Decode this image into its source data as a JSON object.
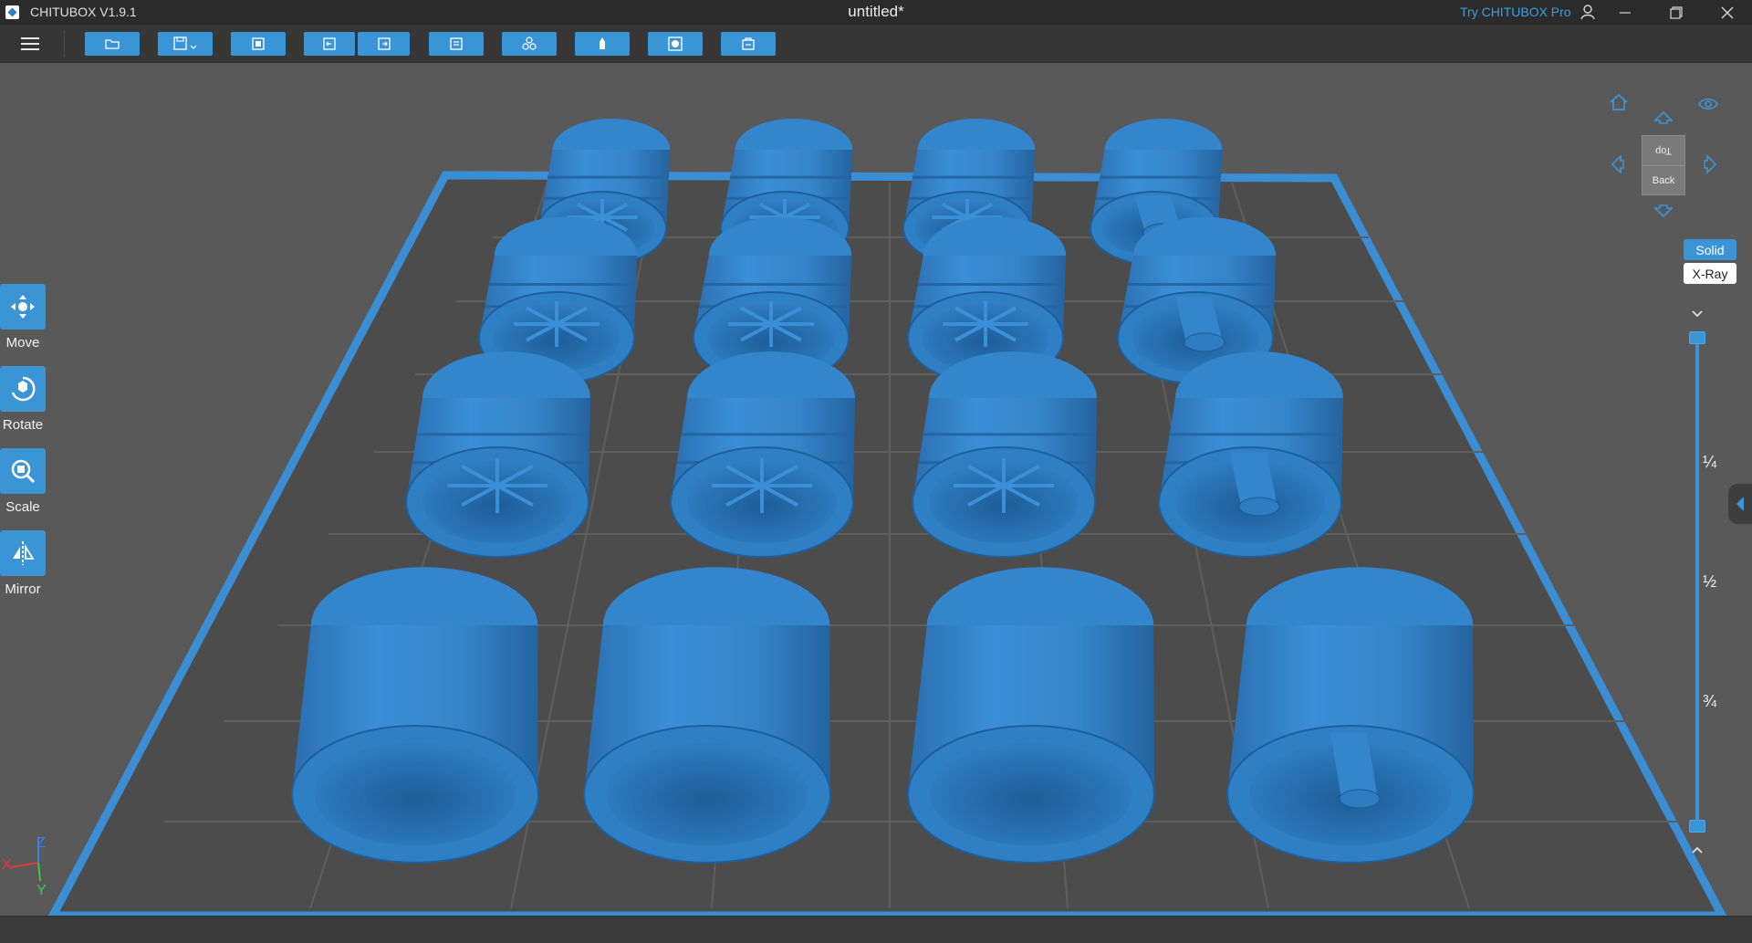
{
  "app": {
    "name": "CHITUBOX V1.9.1",
    "document_title": "untitled*",
    "try_pro": "Try CHITUBOX Pro"
  },
  "toolbar": {
    "buttons": [
      {
        "name": "open-file",
        "icon": "folder-icon"
      },
      {
        "name": "save",
        "icon": "save-icon"
      },
      {
        "name": "screenshot",
        "icon": "capture-icon"
      },
      {
        "name": "undo",
        "icon": "undo-icon"
      },
      {
        "name": "redo",
        "icon": "redo-icon"
      },
      {
        "name": "layout",
        "icon": "layout-icon"
      },
      {
        "name": "multiply",
        "icon": "clone-icon"
      },
      {
        "name": "support",
        "icon": "support-icon"
      },
      {
        "name": "hollow",
        "icon": "hollow-icon"
      },
      {
        "name": "dig-hole",
        "icon": "hole-icon"
      }
    ]
  },
  "left_tools": [
    {
      "label": "Move",
      "icon": "move-icon"
    },
    {
      "label": "Rotate",
      "icon": "rotate-icon"
    },
    {
      "label": "Scale",
      "icon": "scale-icon"
    },
    {
      "label": "Mirror",
      "icon": "mirror-icon"
    }
  ],
  "view_cube": {
    "top_face": "Top",
    "back_face": "Back"
  },
  "render_mode": {
    "solid": "Solid",
    "xray": "X-Ray",
    "active": "Solid"
  },
  "layer_slider": {
    "quarter": "¼",
    "half": "½",
    "three_quarter": "¾"
  },
  "axes": {
    "x": "X",
    "y": "Y",
    "z": "Z"
  },
  "colors": {
    "accent": "#3b94d6",
    "model": "#2f7fc4",
    "plate": "#4b4b4b",
    "background": "#595959"
  }
}
